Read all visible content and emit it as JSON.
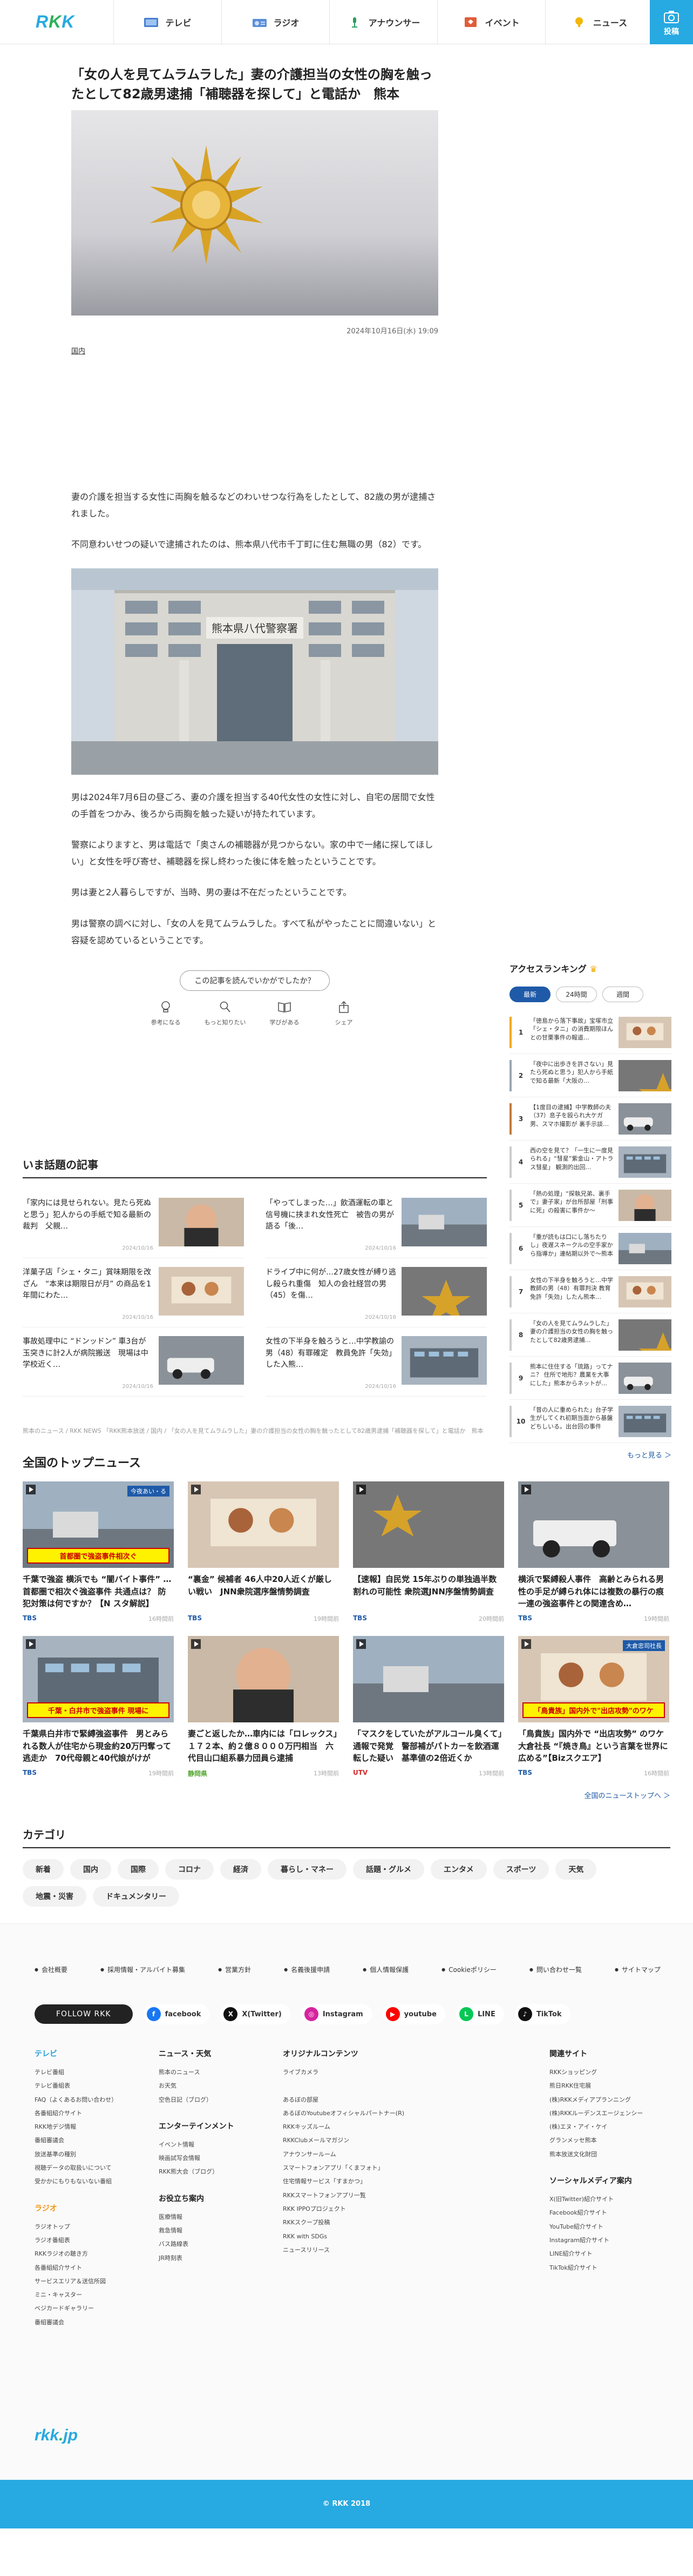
{
  "header": {
    "logo": "RKK",
    "nav": [
      {
        "label": "テレビ",
        "icon": "tv-icon"
      },
      {
        "label": "ラジオ",
        "icon": "radio-icon"
      },
      {
        "label": "アナウンサー",
        "icon": "announcer-icon"
      },
      {
        "label": "イベント",
        "icon": "event-icon"
      },
      {
        "label": "ニュース",
        "icon": "news-icon"
      }
    ],
    "submit_label": "投稿"
  },
  "article": {
    "title": "「女の人を見てムラムラした」妻の介護担当の女性の胸を触ったとして82歳男逮捕「補聴器を探して」と電話か　熊本",
    "date": "2024年10月16日(水) 19:09",
    "category": "国内",
    "p1": "妻の介護を担当する女性に両胸を触るなどのわいせつな行為をしたとして、82歳の男が逮捕されました。",
    "p2": "不同意わいせつの疑いで逮捕されたのは、熊本県八代市千丁町に住む無職の男（82）です。",
    "p3": "男は2024年7月6日の昼ごろ、妻の介護を担当する40代女性の女性に対し、自宅の居間で女性の手首をつかみ、後ろから両胸を触った疑いが持たれています。",
    "p4": "警察によりますと、男は電話で「奥さんの補聴器が見つからない。家の中で一緒に探してほしい」と女性を呼び寄せ、補聴器を探し終わった後に体を触ったということです。",
    "p5": "男は妻と2人暮らしですが、当時、男の妻は不在だったということです。",
    "p6": "男は警察の調べに対し、「女の人を見てムラムラした。すべて私がやったことに間違いない」と容疑を認めているということです。",
    "photo_sign": "熊本県八代警察署",
    "question": "この記事を読んでいかがでしたか？",
    "reactions": [
      "参考になる",
      "もっと知りたい",
      "学びがある",
      "シェア"
    ]
  },
  "ranking": {
    "title": "アクセスランキング",
    "tabs": [
      "最新",
      "24時間",
      "週間"
    ],
    "items": [
      {
        "n": "1",
        "text": "「徳島から落下事故」宝塚市立「シェ・タニ」の消費期限ほんとの甘栗事件の報道…",
        "color": "#f2a900"
      },
      {
        "n": "2",
        "text": "「夜中に出歩きを許さない」見たら死ぬと思う」犯人から手紙で知る最新「大阪の…",
        "color": "#9aa5b1"
      },
      {
        "n": "3",
        "text": "【1度目の逮捕】中学教師の夫（37）息子を殴られ大ケガ男、スマホ撮影が 裏手示談…",
        "color": "#c07a3b"
      },
      {
        "n": "4",
        "text": "西の空を見て？「一生に一度見られる」“彗星”紫金山・アトラス彗星」 観測的出回…",
        "color": "#cccccc"
      },
      {
        "n": "5",
        "text": "「熱の処理」“探執兄弟、裏手で」妻子家」が台所部屋「刑事に死」の殺害に事件か〜",
        "color": "#cccccc"
      },
      {
        "n": "6",
        "text": "「重が読もは口にし落ちたりし」夜遅スネークルの空手家から指導か」連帖期以外で〜熊本",
        "color": "#cccccc"
      },
      {
        "n": "7",
        "text": "女性の下半身を触ろうと…中学教師の男（48）有罪判決 教育免許「失効」したん熊本…",
        "color": "#cccccc"
      },
      {
        "n": "8",
        "text": "「女の人を見てムラムラした」妻の介護担当の女性の胸を触ったとして82歳男逮捕…",
        "color": "#cccccc"
      },
      {
        "n": "9",
        "text": "熊本に住住する「琉路」ってナニ？ 住所で地形？農業を大事にした」熊本からネットが…",
        "color": "#cccccc"
      },
      {
        "n": "10",
        "text": "「昔の人に重められた」台子学生がしてくれ初期当面から基盤どちしいる。出台回の事件",
        "color": "#cccccc"
      }
    ],
    "more": "もっと見る ＞"
  },
  "hot": {
    "title": "いま話題の記事",
    "items": [
      {
        "text": "「家内には見せられない。見たら死ぬと思う」犯人からの手紙で知る最新の裁判　父親…",
        "date": "2024/10/16"
      },
      {
        "text": "「やってしまった…」飲酒運転の車と信号機に挟まれ女性死亡　被告の男が語る「後…",
        "date": "2024/10/16"
      },
      {
        "text": "洋菓子店「シェ・タニ」賞味期限を改ざん　“本来は期限日が月” の商品を1年間にわた…",
        "date": "2024/10/16"
      },
      {
        "text": "ドライブ中に何が…27歳女性が縛り逃し殺られ重傷　知人の会社経営の男（45）を傷…",
        "date": "2024/10/16"
      },
      {
        "text": "事故処理中に “ドンッドン” 車3台が玉突きに計2人が病院搬送　現場は中学校近く…",
        "date": "2024/10/16"
      },
      {
        "text": "女性の下半身を触ろうと…中学教諭の男（48）有罪確定　教員免許「失効」した入熊…",
        "date": "2024/10/16"
      }
    ]
  },
  "breadcrumb": "熊本のニュース / RKK NEWS 「RKK熊本放送 / 国内 / 「女の人を見てムラムラした」妻の介護担当の女性の胸を触ったとして82歳男逮捕「補聴器を探して」と電話か　熊本",
  "top": {
    "title": "全国のトップニュース",
    "items": [
      {
        "text": "千葉で強盗 横浜でも “闇バイト事件” …首都圏で相次ぐ強盗事件 共通点は？ 防犯対策は何ですか？【N スタ解説】",
        "src": "TBS",
        "srcColor": "#1e5aa8",
        "time": "16時間前",
        "overlay": "首都圏で強盗事件相次ぐ",
        "tag": "今夜あい・る"
      },
      {
        "text": "“裏金” 候補者 46人中20人近くが厳しい戦い　JNN衆院選序盤情勢調査",
        "src": "TBS",
        "srcColor": "#1e5aa8",
        "time": "19時間前",
        "overlay": "",
        "tag": ""
      },
      {
        "text": "【速報】自民党 15年ぶりの単独過半数割れの可能性 衆院選JNN序盤情勢調査",
        "src": "TBS",
        "srcColor": "#1e5aa8",
        "time": "20時間前",
        "overlay": "",
        "tag": ""
      },
      {
        "text": "横浜で緊縛殺人事件　高齢とみられる男性の手足が縛られ体には複数の暴行の痕　一連の強盗事件との関連含め…",
        "src": "TBS",
        "srcColor": "#1e5aa8",
        "time": "19時間前",
        "overlay": "",
        "tag": ""
      },
      {
        "text": "千葉県白井市で緊縛強盗事件　男とみられる数人が住宅から現金約20万円奪って逃走か　70代母親と40代娘がけが",
        "src": "TBS",
        "srcColor": "#1e5aa8",
        "time": "19時間前",
        "overlay": "千葉・白井市で強盗事件 現場に",
        "tag": ""
      },
      {
        "text": "妻ごと返したか…車内には「ロレックス」１７２本、約２億８０００万円相当　六代目山口組系暴力団員ら逮捕",
        "src": "静岡県",
        "srcColor": "#55a630",
        "time": "13時間前",
        "overlay": "",
        "tag": ""
      },
      {
        "text": "「マスクをしていたがアルコール臭くて」通報で発覚　警部補がパトカーを飲酒運転した疑い　基準値の2倍近くか",
        "src": "UTV",
        "srcColor": "#d62828",
        "time": "13時間前",
        "overlay": "",
        "tag": ""
      },
      {
        "text": "「鳥貴族」国内外で “出店攻勢” のワケ大倉社長 “『焼き鳥』という言葉を世界に広める”【Bizスクエア】",
        "src": "TBS",
        "srcColor": "#1e5aa8",
        "time": "16時間前",
        "overlay": "「鳥貴族」国内外で\"出店攻勢\"のワケ",
        "tag": "大倉忠司社長"
      }
    ],
    "more": "全国のニューストップへ ＞"
  },
  "category": {
    "title": "カテゴリ",
    "chips": [
      "新着",
      "国内",
      "国際",
      "コロナ",
      "経済",
      "暮らし・マネー",
      "話題・グルメ",
      "エンタメ",
      "スポーツ",
      "天気",
      "地震・災害",
      "ドキュメンタリー"
    ]
  },
  "footer": {
    "links": [
      "会社概要",
      "採用情報・アルバイト募集",
      "営業方針",
      "名義後援申請",
      "個人情報保護",
      "Cookieポリシー",
      "問い合わせ一覧",
      "サイトマップ"
    ],
    "follow": "FOLLOW RKK",
    "social": [
      {
        "label": "facebook",
        "color": "#1877f2",
        "glyph": "f"
      },
      {
        "label": "X(Twitter)",
        "color": "#111111",
        "glyph": "X"
      },
      {
        "label": "Instagram",
        "color": "#d6249f",
        "glyph": "◎"
      },
      {
        "label": "youtube",
        "color": "#ff0000",
        "glyph": "▶"
      },
      {
        "label": "LINE",
        "color": "#06c755",
        "glyph": "L"
      },
      {
        "label": "TikTok",
        "color": "#111111",
        "glyph": "♪"
      }
    ],
    "col1": {
      "tv_title": "テレビ",
      "tv": [
        "テレビ番組",
        "テレビ番組表",
        "FAQ（よくあるお問い合わせ）",
        "各番組紹介サイト",
        "RKK地デジ情報",
        "番組審議会",
        "放送基準の種別",
        "視聴データの取扱いについて",
        "受かかにもりもないない番組"
      ],
      "radio_title": "ラジオ",
      "radio": [
        "ラジオトップ",
        "ラジオ番組表",
        "RKKラジオの聴き方",
        "各番組紹介サイト",
        "サービスエリア＆送信所図",
        "ミニ・キャスター",
        "ベジカードギャラリー",
        "番組審議会"
      ]
    },
    "col2": {
      "news_title": "ニュース・天気",
      "news": [
        "熊本のニュース",
        "お天気",
        "空色日記（ブログ）"
      ],
      "ent_title": "エンターテインメント",
      "ent": [
        "イベント情報",
        "映画試写会情報",
        "RKK熊大会（ブログ）"
      ],
      "life_title": "お役立ち案内",
      "life": [
        "医療情報",
        "救急情報",
        "バス路線表",
        "JR時刻表"
      ]
    },
    "col3": {
      "title": "オリジナルコンテンツ",
      "items": [
        "ライブカメラ",
        "",
        "あるぼの部屋",
        "あるぼのYoutubeオフィシャルパートナー(R)",
        "RKKキッズルーム",
        "RKKClubメールマガジン",
        "アナウンサールーム",
        "スマートフォンアプリ「くまフォト」",
        "住宅情報サービス「すまかつ」",
        "RKKスマートフォンアプリ一覧",
        "RKK IPPOプロジェクト",
        "RKKスクープ投稿",
        "RKK with SDGs",
        "ニュースリリース"
      ]
    },
    "col4": {
      "title": "関連サイト",
      "items": [
        "RKKショッピング",
        "熊日RKK住宅展",
        "(株)RKKメディアプランニング",
        "(株)RKKルーデンスエージェンシー",
        "(株)エヌ・アイ・ケイ",
        "グランメッセ熊本",
        "熊本放送文化財団"
      ],
      "social_title": "ソーシャルメディア案内",
      "social": [
        "X(旧Twitter)紹介サイト",
        "Facebook紹介サイト",
        "YouTube紹介サイト",
        "Instagram紹介サイト",
        "LINE紹介サイト",
        "TikTok紹介サイト"
      ]
    },
    "logo": "rkk.jp",
    "copyright": "© RKK 2018"
  }
}
